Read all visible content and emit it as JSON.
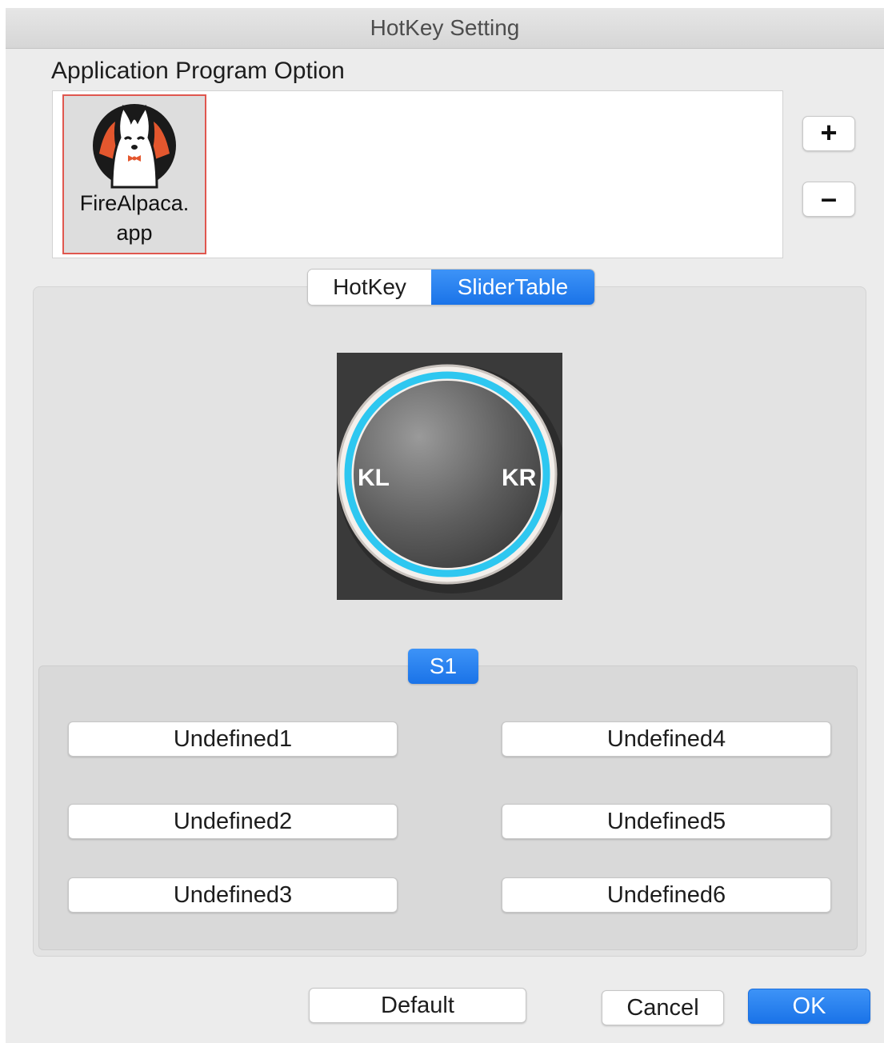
{
  "window": {
    "title": "HotKey Setting"
  },
  "apps": {
    "section_label": "Application Program Option",
    "items": [
      {
        "name": "FireAlpaca.\napp",
        "icon": "alpaca-app-icon"
      }
    ],
    "add_label": "+",
    "remove_label": "–"
  },
  "tabs": [
    {
      "label": "HotKey",
      "selected": false
    },
    {
      "label": "SliderTable",
      "selected": true
    }
  ],
  "dial": {
    "left_label": "KL",
    "right_label": "KR"
  },
  "slider": {
    "selected_label": "S1"
  },
  "keys": {
    "undefined1": "Undefined1",
    "undefined2": "Undefined2",
    "undefined3": "Undefined3",
    "undefined4": "Undefined4",
    "undefined5": "Undefined5",
    "undefined6": "Undefined6"
  },
  "footer": {
    "default_label": "Default",
    "cancel_label": "Cancel",
    "ok_label": "OK"
  },
  "colors": {
    "accent": "#1a73e8",
    "ring": "#2ec7f0",
    "selection_border": "#e0574f"
  }
}
